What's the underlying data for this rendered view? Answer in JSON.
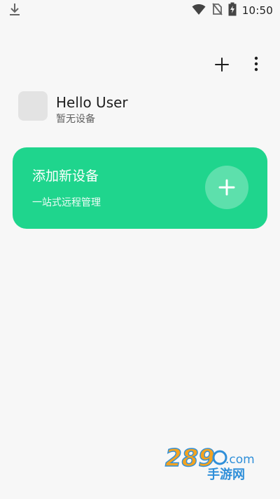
{
  "status_bar": {
    "time": "10:50",
    "icons": [
      "download-icon",
      "wifi-icon",
      "no-sim-icon",
      "battery-charging-icon"
    ]
  },
  "toolbar": {
    "add_icon": "plus-icon",
    "more_icon": "more-vertical-icon"
  },
  "profile": {
    "name": "Hello User",
    "subtitle": "暂无设备"
  },
  "add_device_card": {
    "title": "添加新设备",
    "subtitle": "一站式远程管理",
    "icon": "plus-icon",
    "color": "#1fd58d"
  },
  "watermark": {
    "text": "289.com 手游网"
  }
}
